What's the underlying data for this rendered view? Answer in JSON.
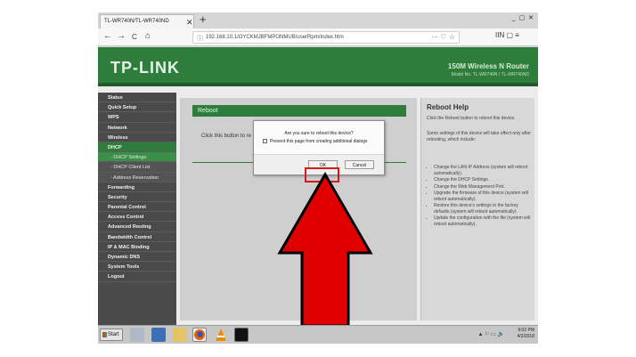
{
  "browser": {
    "tab_title": "TL-WR740N/TL-WR740ND",
    "tab_close": "✕",
    "new_tab": "+",
    "window_controls": "_ ▢ ✕",
    "back": "←",
    "forward": "→",
    "reload": "C",
    "home": "⌂",
    "url": "192.168.10.1/OYCKMJBFMPONMUB/userRpm/Index.htm",
    "url_actions": "··· ♡ ☆",
    "toolbar_right": "IIN ▢ ≡"
  },
  "router": {
    "logo": "TP-LINK",
    "model_title": "150M Wireless N Router",
    "model_sub": "Model No. TL-WR740N / TL-WR740ND",
    "menu": [
      {
        "label": "Status"
      },
      {
        "label": "Quick Setup"
      },
      {
        "label": "WPS"
      },
      {
        "label": "Network"
      },
      {
        "label": "Wireless"
      },
      {
        "label": "DHCP",
        "active": true
      },
      {
        "label": "- DHCP Settings",
        "sub": true,
        "active": true
      },
      {
        "label": "- DHCP Client List",
        "sub": true
      },
      {
        "label": "- Address Reservation",
        "sub": true
      },
      {
        "label": "Forwarding"
      },
      {
        "label": "Security"
      },
      {
        "label": "Parental Control"
      },
      {
        "label": "Access Control"
      },
      {
        "label": "Advanced Routing"
      },
      {
        "label": "Bandwidth Control"
      },
      {
        "label": "IP & MAC Binding"
      },
      {
        "label": "Dynamic DNS"
      },
      {
        "label": "System Tools"
      },
      {
        "label": "Logout"
      }
    ],
    "content_title": "Reboot",
    "content_text": "Click this button to re",
    "help": {
      "title": "Reboot Help",
      "intro": "Click the Reboot button to reboot this device.",
      "note": "Some settings of this device will take effect only after rebooting, which include:",
      "items": [
        "Change the LAN IP Address (system will reboot automatically).",
        "Change the DHCP Settings.",
        "Change the Web Management Port.",
        "Upgrade the firmware of this device (system will reboot automatically).",
        "Restore this device's settings to the factory defaults (system will reboot automatically).",
        "Update the configuration with the file (system will reboot automatically)."
      ]
    }
  },
  "dialog": {
    "message": "Are you sure to reboot this device?",
    "checkbox_label": "Prevent this page from creating additional dialogs",
    "ok": "OK",
    "cancel": "Cancel"
  },
  "taskbar": {
    "start": "Start",
    "time": "9:02 PM",
    "date": "4/2/2018",
    "tray_icons": "▲ ⚐ ▭ 🔊"
  },
  "colors": {
    "brand_green": "#2f7d3c",
    "arrow_red": "#e00000",
    "highlight_red": "#d11a1a"
  },
  "icons": {
    "arrow": "up-arrow-icon"
  }
}
